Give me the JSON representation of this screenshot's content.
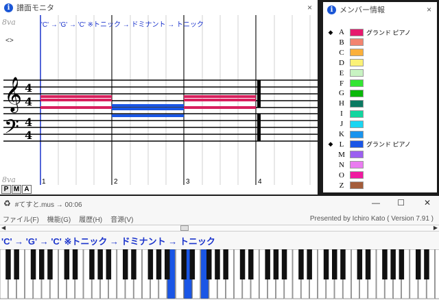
{
  "score_window": {
    "title": "譜面モニタ",
    "close": "×",
    "octave_top": "8va",
    "octave_bottom": "8va",
    "toggle": "<>",
    "chord_text": "'C' → 'G' → 'C'  ※トニック → ドミナント → トニック",
    "bar_numbers": [
      "1",
      "2",
      "3",
      "4"
    ],
    "tabs": [
      "P",
      "M",
      "A"
    ],
    "active_tab": "A"
  },
  "members_window": {
    "title": "メンバー情報",
    "close": "×",
    "members": [
      {
        "bullet": "◆",
        "letter": "A",
        "color": "#e6196e",
        "name": "グランド ピアノ"
      },
      {
        "bullet": "",
        "letter": "B",
        "color": "#f28470",
        "name": ""
      },
      {
        "bullet": "",
        "letter": "C",
        "color": "#fbb03b",
        "name": ""
      },
      {
        "bullet": "",
        "letter": "D",
        "color": "#fbf176",
        "name": ""
      },
      {
        "bullet": "",
        "letter": "E",
        "color": "#c8f3c2",
        "name": ""
      },
      {
        "bullet": "",
        "letter": "F",
        "color": "#33e533",
        "name": ""
      },
      {
        "bullet": "",
        "letter": "G",
        "color": "#0ab80a",
        "name": ""
      },
      {
        "bullet": "",
        "letter": "H",
        "color": "#0b7a62",
        "name": ""
      },
      {
        "bullet": "",
        "letter": "I",
        "color": "#12d6a0",
        "name": ""
      },
      {
        "bullet": "",
        "letter": "J",
        "color": "#1ad6f2",
        "name": ""
      },
      {
        "bullet": "",
        "letter": "K",
        "color": "#1a94ee",
        "name": ""
      },
      {
        "bullet": "◆",
        "letter": "L",
        "color": "#1a56e6",
        "name": "グランド ピアノ"
      },
      {
        "bullet": "",
        "letter": "M",
        "color": "#9b5ff0",
        "name": ""
      },
      {
        "bullet": "",
        "letter": "N",
        "color": "#ea7bf0",
        "name": ""
      },
      {
        "bullet": "",
        "letter": "O",
        "color": "#f01aa0",
        "name": ""
      },
      {
        "bullet": "",
        "letter": "Z",
        "color": "#a45c3a",
        "name": ""
      }
    ]
  },
  "main_window": {
    "title": "#てすと.mus → 00:06",
    "minimize": "—",
    "maximize": "☐",
    "close": "✕",
    "menus": [
      "ファイル(F)",
      "機能(G)",
      "履歴(H)",
      "音源(V)"
    ],
    "credit": "Presented by Ichiro Kato ( Version 7.91 )",
    "chord_text": "'C' → 'G' → 'C'  ※トニック → ドミナント → トニック",
    "pressed_keys_color": "#1a56e6"
  }
}
